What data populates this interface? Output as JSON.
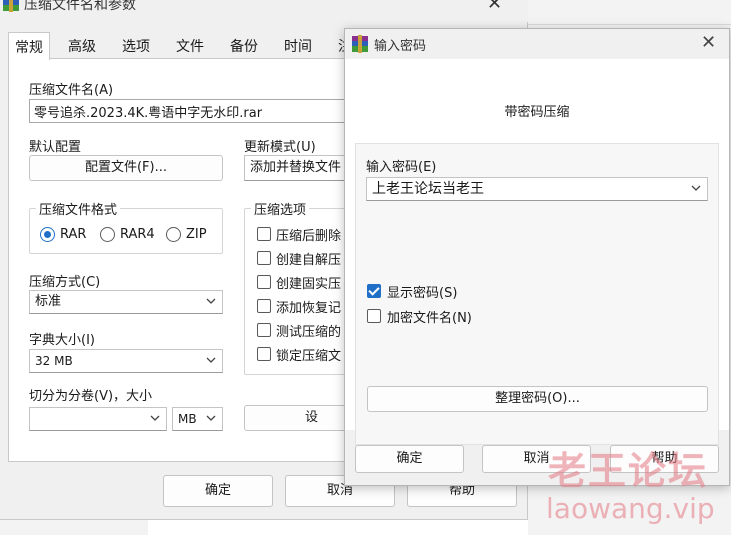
{
  "main_dialog": {
    "title": "压缩文件名和参数",
    "tabs": [
      {
        "label": "常规"
      },
      {
        "label": "高级"
      },
      {
        "label": "选项"
      },
      {
        "label": "文件"
      },
      {
        "label": "备份"
      },
      {
        "label": "时间"
      },
      {
        "label": "注"
      }
    ],
    "archive_name_label": "压缩文件名(A)",
    "archive_name_value": "零号追杀.2023.4K.粤语中字无水印.rar",
    "default_profile_label": "默认配置",
    "profile_button": "配置文件(F)...",
    "update_mode_label": "更新模式(U)",
    "update_mode_value": "添加并替换文件",
    "format_group": {
      "title": "压缩文件格式",
      "options": [
        {
          "label": "RAR",
          "checked": true
        },
        {
          "label": "RAR4",
          "checked": false
        },
        {
          "label": "ZIP",
          "checked": false
        }
      ]
    },
    "options_group": {
      "title": "压缩选项",
      "items": [
        {
          "label": "压缩后删除",
          "checked": false
        },
        {
          "label": "创建自解压",
          "checked": false
        },
        {
          "label": "创建固实压",
          "checked": false
        },
        {
          "label": "添加恢复记",
          "checked": false
        },
        {
          "label": "测试压缩的",
          "checked": false
        },
        {
          "label": "锁定压缩文",
          "checked": false
        }
      ]
    },
    "method_label": "压缩方式(C)",
    "method_value": "标准",
    "dict_label": "字典大小(I)",
    "dict_value": "32 MB",
    "split_label": "切分为分卷(V)，大小",
    "split_value": "",
    "split_unit": "MB",
    "set_password_button": "设",
    "ok_button": "确定",
    "cancel_button": "取消",
    "help_button": "帮助"
  },
  "password_dialog": {
    "title": "输入密码",
    "heading": "带密码压缩",
    "password_label": "输入密码(E)",
    "password_value": "上老王论坛当老王",
    "show_password": {
      "label": "显示密码(S)",
      "checked": true
    },
    "encrypt_names": {
      "label": "加密文件名(N)",
      "checked": false
    },
    "organize_button": "整理密码(O)...",
    "ok_button": "确定",
    "cancel_button": "取消",
    "help_button": "帮助"
  },
  "watermark": {
    "line1": "老王论坛",
    "line2": "laowang.vip"
  },
  "colors": {
    "accent": "#1f6fc7",
    "dialog_bg": "#f0f0f0",
    "panel_bg": "#ffffff",
    "watermark": "#e47882"
  }
}
